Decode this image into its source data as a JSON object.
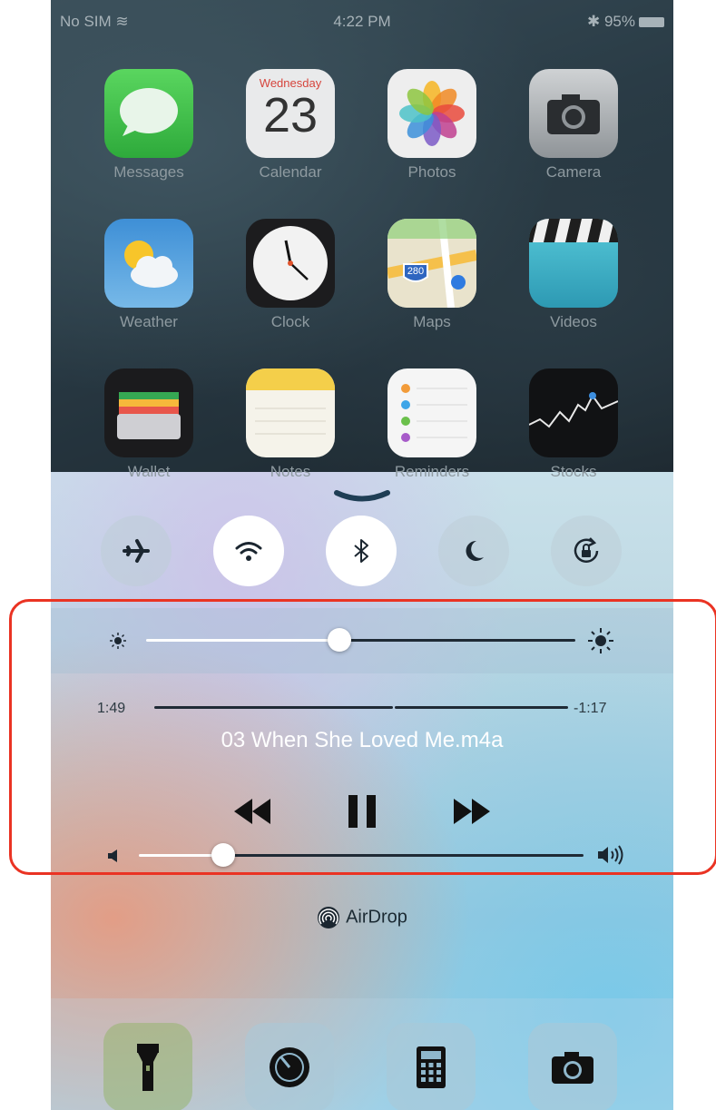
{
  "status_bar": {
    "carrier": "No SIM",
    "time": "4:22 PM",
    "battery": "95%"
  },
  "apps": [
    {
      "label": "Messages",
      "icon": "messages-icon"
    },
    {
      "label": "Calendar",
      "icon": "calendar-icon",
      "day": "Wednesday",
      "date": "23"
    },
    {
      "label": "Photos",
      "icon": "photos-icon"
    },
    {
      "label": "Camera",
      "icon": "camera-icon"
    },
    {
      "label": "Weather",
      "icon": "weather-icon"
    },
    {
      "label": "Clock",
      "icon": "clock-icon"
    },
    {
      "label": "Maps",
      "icon": "maps-icon",
      "road": "280"
    },
    {
      "label": "Videos",
      "icon": "videos-icon"
    },
    {
      "label": "Wallet",
      "icon": "wallet-icon"
    },
    {
      "label": "Notes",
      "icon": "notes-icon"
    },
    {
      "label": "Reminders",
      "icon": "reminders-icon"
    },
    {
      "label": "Stocks",
      "icon": "stocks-icon"
    }
  ],
  "control_center": {
    "toggles": [
      {
        "name": "airplane-mode",
        "icon": "airplane-icon",
        "on": false
      },
      {
        "name": "wifi",
        "icon": "wifi-icon",
        "on": true
      },
      {
        "name": "bluetooth",
        "icon": "bluetooth-icon",
        "on": true
      },
      {
        "name": "do-not-disturb",
        "icon": "moon-icon",
        "on": false
      },
      {
        "name": "rotation-lock",
        "icon": "rotation-lock-icon",
        "on": false
      }
    ],
    "brightness_level": 0.45,
    "now_playing": {
      "elapsed": "1:49",
      "remaining": "-1:17",
      "progress": 0.58,
      "title": "03 When She Loved Me.m4a"
    },
    "volume_level": 0.19,
    "airdrop_label": "AirDrop",
    "tools": [
      {
        "name": "flashlight",
        "icon": "flashlight-icon"
      },
      {
        "name": "timer",
        "icon": "timer-icon"
      },
      {
        "name": "calculator",
        "icon": "calculator-icon"
      },
      {
        "name": "camera",
        "icon": "camera-icon"
      }
    ],
    "colors": {
      "highlight": "#ea3323",
      "toggle_on": "#ffffff"
    }
  }
}
